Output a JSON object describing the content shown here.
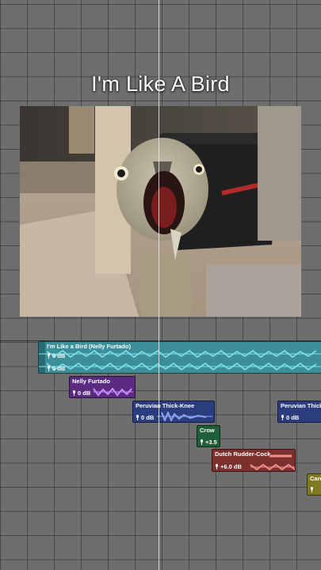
{
  "video": {
    "title": "I'm Like A Bird"
  },
  "clips": {
    "main": {
      "name": "I'm Like a Bird (Nelly Furtado)",
      "gain_top": "0 dB",
      "gain_bottom": "0 dB",
      "color": "#38b3c0"
    },
    "nelly": {
      "name": "Nelly Furtado",
      "gain": "0 dB",
      "color": "#8a43c6"
    },
    "thickknee1": {
      "name": "Peruvian Thick-Knee",
      "gain": "0 dB",
      "color": "#3b56b6"
    },
    "thickknee2": {
      "name": "Peruvian Thick",
      "gain": "0 dB",
      "color": "#3b56b6"
    },
    "crow": {
      "name": "Crow",
      "gain": "+3.5",
      "color": "#2f8a4e"
    },
    "rudder": {
      "name": "Dutch Rudder-Cock",
      "gain": "+6.0 dB",
      "color": "#b94a46"
    },
    "card": {
      "name": "Card",
      "color": "#b8b238"
    }
  }
}
